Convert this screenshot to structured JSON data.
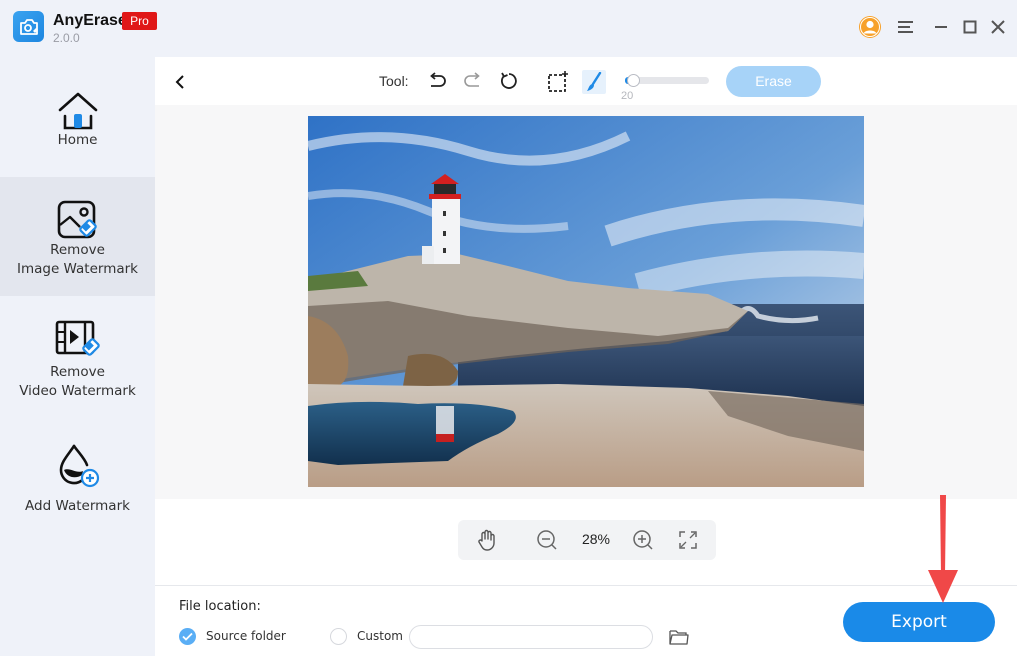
{
  "app": {
    "name": "AnyErase",
    "version": "2.0.0",
    "badge": "Pro"
  },
  "titlebar": {
    "icons": [
      "account-icon",
      "menu-icon",
      "minimize-icon",
      "maximize-icon",
      "close-icon"
    ]
  },
  "sidebar": {
    "items": [
      {
        "label_line1": "Home",
        "label_line2": "",
        "icon": "home-icon",
        "active": false
      },
      {
        "label_line1": "Remove",
        "label_line2": "Image Watermark",
        "icon": "image-eraser-icon",
        "active": true
      },
      {
        "label_line1": "Remove",
        "label_line2": "Video Watermark",
        "icon": "video-eraser-icon",
        "active": false
      },
      {
        "label_line1": "Add Watermark",
        "label_line2": "",
        "icon": "drop-add-icon",
        "active": false
      }
    ]
  },
  "toolbar": {
    "back_icon": "chevron-left-icon",
    "tool_label": "Tool:",
    "tools": [
      "undo-icon",
      "redo-icon",
      "reset-icon",
      "rect-select-icon",
      "brush-icon"
    ],
    "brush_size": 20,
    "brush_size_min": 0,
    "brush_size_max": 100,
    "brush_size_label": "20",
    "erase_label": "Erase",
    "erase_enabled": false
  },
  "canvas": {
    "image_description": "Lighthouse on rocky coast with tidal pool reflection"
  },
  "zoom_bar": {
    "zoom_label": "28%",
    "icons": [
      "hand-icon",
      "zoom-out-icon",
      "zoom-in-icon",
      "fullscreen-icon"
    ]
  },
  "file_location": {
    "label": "File location:",
    "options": [
      {
        "label": "Source folder",
        "checked": true
      },
      {
        "label": "Custom",
        "checked": false
      }
    ],
    "custom_path_value": "",
    "custom_path_placeholder": ""
  },
  "export": {
    "label": "Export"
  },
  "colors": {
    "accent": "#1a8ae8",
    "pro_badge": "#e01818",
    "account": "#f7a12a",
    "annotation_arrow": "#f04848"
  }
}
